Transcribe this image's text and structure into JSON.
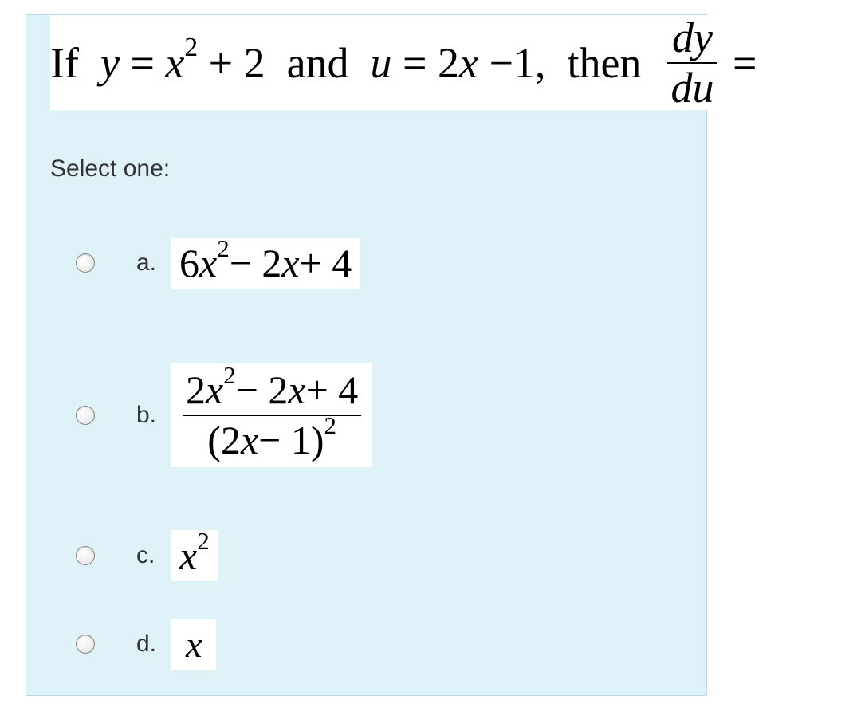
{
  "question": {
    "if_word": "If",
    "eq1_left": "y",
    "eq1_right_a": "x",
    "eq1_right_b": "+ 2",
    "and_word": "and",
    "eq2_left": "u",
    "eq2_right": "2x − 1,",
    "then_word": "then",
    "frac_num": "dy",
    "frac_den": "du",
    "equals": "="
  },
  "select_label": "Select one:",
  "options": {
    "a": {
      "letter": "a.",
      "coef1": "6",
      "var1": "x",
      "mid": " − 2",
      "var2": "x",
      "tail": " + 4"
    },
    "b": {
      "letter": "b.",
      "num_coef1": "2",
      "num_var1": "x",
      "num_mid": " − 2",
      "num_var2": "x",
      "num_tail": " + 4",
      "den_open": "(",
      "den_coef": "2",
      "den_var": "x",
      "den_mid": " − 1",
      "den_close": ")"
    },
    "c": {
      "letter": "c.",
      "var": "x"
    },
    "d": {
      "letter": "d.",
      "var": "x"
    }
  }
}
